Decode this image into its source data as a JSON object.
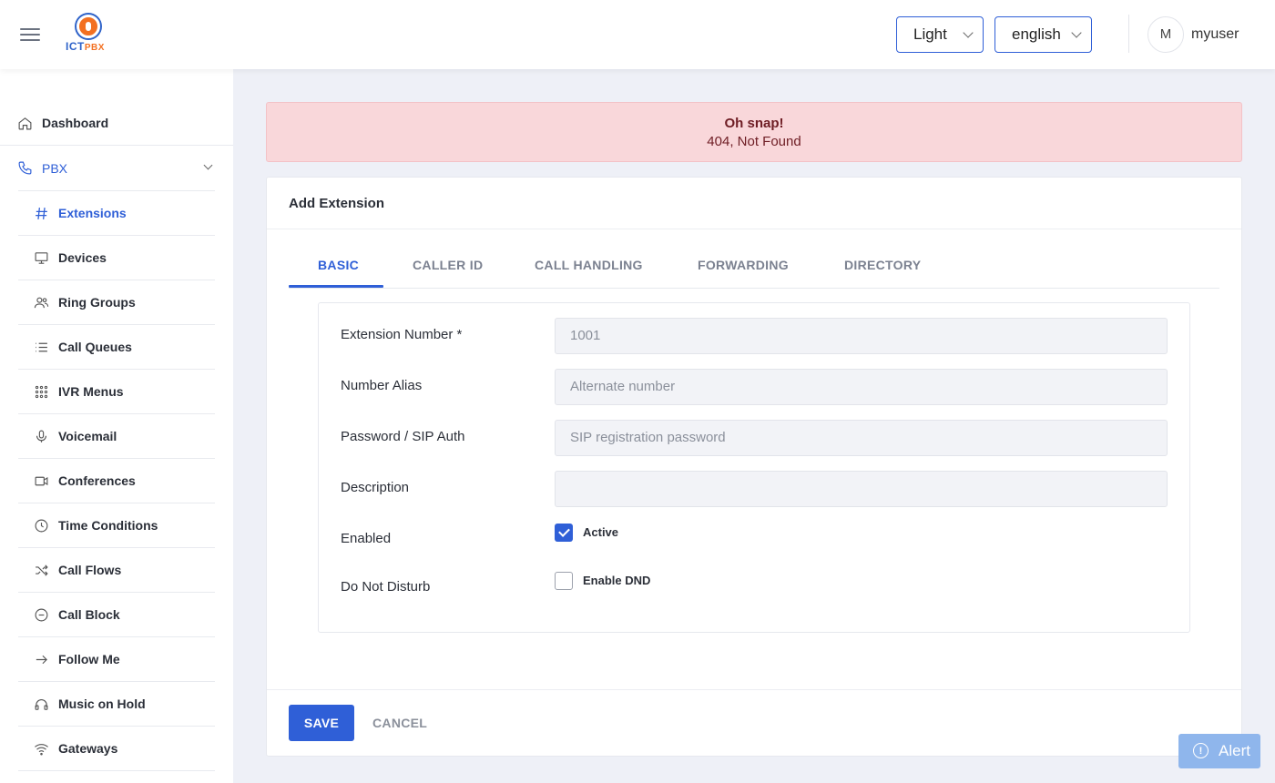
{
  "header": {
    "theme_select": "Light",
    "language_select": "english",
    "avatar_initial": "M",
    "username": "myuser",
    "logo_text": "ICT",
    "logo_text_accent": "PBX"
  },
  "sidebar": {
    "items": [
      {
        "label": "Dashboard",
        "icon": "home-icon"
      },
      {
        "label": "PBX",
        "icon": "phone-icon"
      },
      {
        "label": "Extensions",
        "icon": "hash-icon"
      },
      {
        "label": "Devices",
        "icon": "monitor-icon"
      },
      {
        "label": "Ring Groups",
        "icon": "users-icon"
      },
      {
        "label": "Call Queues",
        "icon": "list-icon"
      },
      {
        "label": "IVR Menus",
        "icon": "grid-icon"
      },
      {
        "label": "Voicemail",
        "icon": "mic-icon"
      },
      {
        "label": "Conferences",
        "icon": "video-icon"
      },
      {
        "label": "Time Conditions",
        "icon": "clock-icon"
      },
      {
        "label": "Call Flows",
        "icon": "shuffle-icon"
      },
      {
        "label": "Call Block",
        "icon": "minus-circle-icon"
      },
      {
        "label": "Follow Me",
        "icon": "arrow-right-icon"
      },
      {
        "label": "Music on Hold",
        "icon": "headphones-icon"
      },
      {
        "label": "Gateways",
        "icon": "wifi-icon"
      }
    ]
  },
  "alert_banner": {
    "title": "Oh snap!",
    "message": "404, Not Found"
  },
  "card": {
    "title": "Add Extension",
    "tabs": [
      "BASIC",
      "CALLER ID",
      "CALL HANDLING",
      "FORWARDING",
      "DIRECTORY"
    ],
    "active_tab": "BASIC",
    "fields": [
      {
        "label": "Extension Number *",
        "placeholder": "1001"
      },
      {
        "label": "Number Alias",
        "placeholder": "Alternate number"
      },
      {
        "label": "Password / SIP Auth",
        "placeholder": "SIP registration password"
      },
      {
        "label": "Description",
        "placeholder": ""
      }
    ],
    "enabled": {
      "label": "Enabled",
      "checkbox_label": "Active",
      "checked": true
    },
    "dnd": {
      "label": "Do Not Disturb",
      "checkbox_label": "Enable DND",
      "checked": false
    },
    "save_label": "SAVE",
    "cancel_label": "CANCEL"
  },
  "floating_alert": {
    "label": "Alert"
  },
  "colors": {
    "accent": "#2f5fd7",
    "danger_bg": "#f9d7da",
    "danger_text": "#6e1d24"
  }
}
